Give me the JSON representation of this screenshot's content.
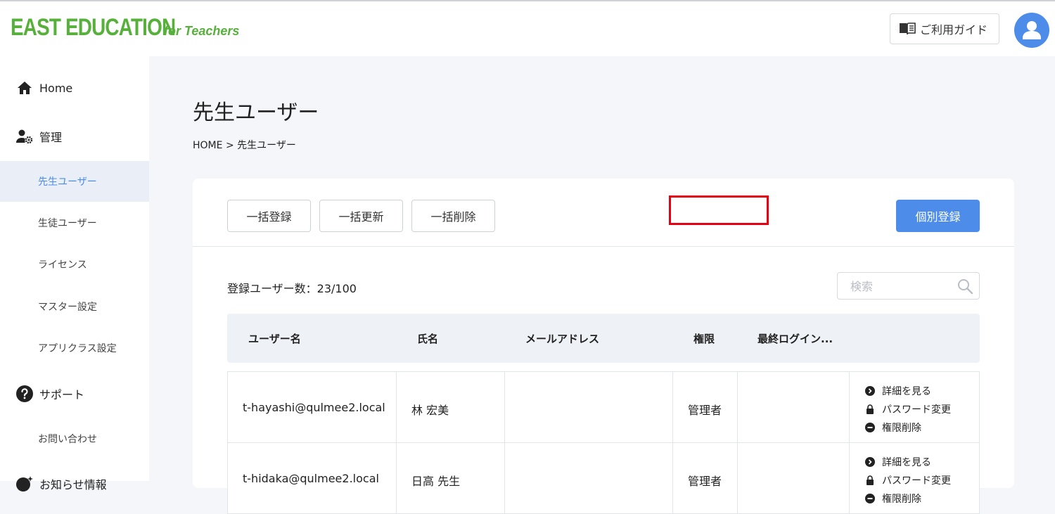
{
  "header": {
    "logo_main": "EAST EDUCATION",
    "logo_sub": "for Teachers",
    "guide_label": "ご利用ガイド",
    "brand_color": "#58b03c"
  },
  "sidebar": {
    "home": "Home",
    "admin": "管理",
    "admin_items": [
      "先生ユーザー",
      "生徒ユーザー",
      "ライセンス",
      "マスター設定",
      "アプリクラス設定"
    ],
    "support": "サポート",
    "support_items": [
      "お問い合わせ"
    ],
    "news": "お知らせ情報"
  },
  "page": {
    "title": "先生ユーザー",
    "breadcrumb_home": "HOME",
    "breadcrumb_sep": ">",
    "breadcrumb_current": "先生ユーザー"
  },
  "toolbar": {
    "bulk_register": "一括登録",
    "bulk_update": "一括更新",
    "bulk_delete": "一括削除",
    "individual_register": "個別登録",
    "accent_color": "#4d8de9"
  },
  "list": {
    "count_label": "登録ユーザー数：23/100",
    "search_placeholder": "検索",
    "columns": [
      "ユーザー名",
      "氏名",
      "メールアドレス",
      "権限",
      "最終ログイン..."
    ],
    "rows": [
      {
        "username": "t-hayashi@qulmee2.local",
        "name": "林 宏美",
        "email": "",
        "role": "管理者",
        "last_login": ""
      },
      {
        "username": "t-hidaka@qulmee2.local",
        "name": "日高 先生",
        "email": "",
        "role": "管理者",
        "last_login": ""
      }
    ],
    "actions": {
      "detail": "詳細を見る",
      "password": "パスワード変更",
      "revoke": "権限削除"
    }
  }
}
